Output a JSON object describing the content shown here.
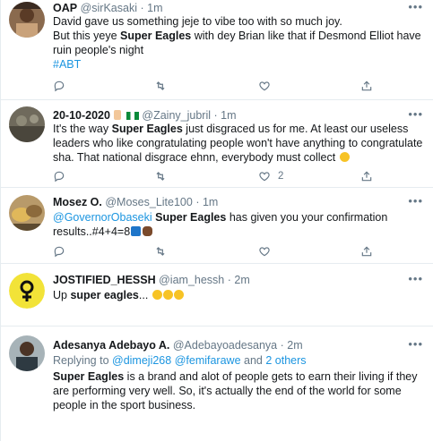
{
  "tweets": [
    {
      "name": "OAP",
      "handle": "@sirKasaki",
      "dot": "·",
      "time": "1m",
      "lines": [
        "David gave us something jeje to vibe too with so much joy.",
        [
          "But this yeye ",
          "Super Eagles",
          " with dey Brian like that if Desmond Elliot have"
        ],
        "ruin people's night",
        "#ABT"
      ],
      "actions": {
        "reply": "",
        "retweet": "",
        "like": ""
      }
    },
    {
      "name": "20-10-2020",
      "handle": "@Zainy_jubril",
      "dot": "·",
      "time": "1m",
      "lines": [
        [
          "It's the way ",
          "Super Eagles",
          " just disgraced us for me. At least our useless"
        ],
        "leaders who like congratulating people won't have anything to congratulate",
        "sha. That national disgrace ehnn, everybody must collect"
      ],
      "actions": {
        "reply": "",
        "retweet": "",
        "like": "2"
      }
    },
    {
      "name": "Mosez O.",
      "handle": "@Moses_Lite100",
      "dot": "·",
      "time": "1m",
      "lines": [
        [
          "@GovernorObaseki",
          " ",
          "Super Eagles",
          " has given you your confirmation"
        ],
        "results..#4+4=8"
      ],
      "actions": {
        "reply": "",
        "retweet": "",
        "like": ""
      }
    },
    {
      "name": "JOSTIFIED_HESSH",
      "handle": "@iam_hessh",
      "dot": "·",
      "time": "2m",
      "lines": [
        [
          "Up ",
          "super eagles",
          "..."
        ]
      ],
      "actions": {
        "reply": "",
        "retweet": "",
        "like": ""
      }
    },
    {
      "name": "Adesanya Adebayo A.",
      "handle": "@Adebayoadesanya",
      "dot": "·",
      "time": "2m",
      "replying": {
        "prefix": "Replying to ",
        "user1": "@dimeji268",
        "user2": "@femifarawe",
        "and": " and ",
        "others": "2 others"
      },
      "lines": [
        [
          "Super Eagles",
          " is a brand and alot of people gets to earn their living if they"
        ],
        "are performing very well. So, it's actually the end of the world for some",
        "people in the sport business."
      ],
      "actions": {
        "reply": "",
        "retweet": "",
        "like": ""
      }
    }
  ],
  "icons": {
    "more": "more-options-icon",
    "reply": "reply-icon",
    "retweet": "retweet-icon",
    "like": "heart-icon",
    "share": "share-icon"
  },
  "colors": {
    "link": "#1b95e0",
    "muted": "#657786",
    "text": "#14171a",
    "divider": "#e6ecf0"
  },
  "more_label": "•••"
}
